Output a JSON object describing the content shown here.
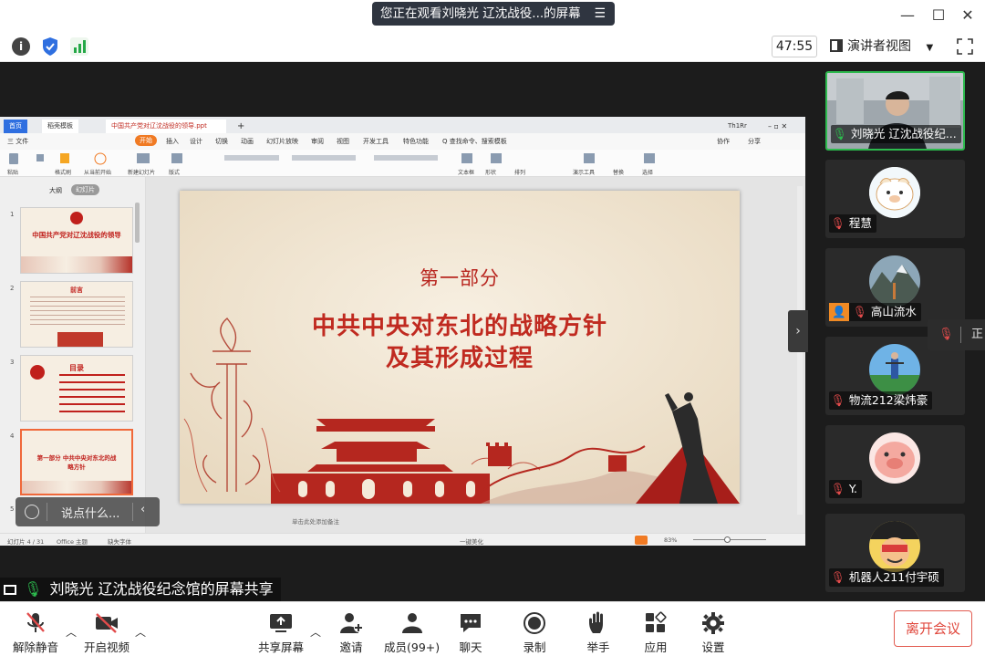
{
  "banner": {
    "text": "您正在观看刘晓光 辽沈战役...的屏幕"
  },
  "toolbar": {
    "timer": "47:55",
    "view_label": "演讲者视图"
  },
  "wps": {
    "tabs": [
      "首页",
      "稻壳模板",
      "中国共产党对辽沈战役的领导.ppt"
    ],
    "user": "Th1Rr",
    "menu": [
      "三 文件",
      "开始",
      "插入",
      "设计",
      "切换",
      "动画",
      "幻灯片放映",
      "审阅",
      "视图",
      "开发工具",
      "特色功能",
      "Q 查找命令、搜索模板"
    ],
    "menu_right": [
      "协作",
      "分享"
    ],
    "ribbon": [
      "粘贴",
      "格式刷",
      "从当前开始",
      "新建幻灯片",
      "版式",
      "文本框",
      "形状",
      "排列",
      "演示工具",
      "替换",
      "选择"
    ],
    "panel_tabs": [
      "大纲",
      "幻灯片"
    ],
    "thumbs": [
      {
        "num": "1",
        "title": "中国共产党对辽沈战役的领导"
      },
      {
        "num": "2",
        "title": "前言"
      },
      {
        "num": "3",
        "title": "目录"
      },
      {
        "num": "4",
        "title": "第一部分 中共中央对东北的战略方针"
      },
      {
        "num": "5",
        "title": ""
      }
    ],
    "slide": {
      "subtitle": "第一部分",
      "title_line1": "中共中央对东北的战略方针",
      "title_line2": "及其形成过程"
    },
    "notes_hint": "单击此处添加备注",
    "status": {
      "slide_count": "幻灯片 4 / 31",
      "theme": "Office 主题",
      "font_missing": "缺失字体",
      "beautify": "一键美化",
      "zoom": "83%"
    }
  },
  "chat": {
    "placeholder": "说点什么..."
  },
  "share_label": "刘晓光 辽沈战役纪念馆的屏幕共享",
  "participants": [
    {
      "name": "刘晓光 辽沈战役纪...",
      "active": true
    },
    {
      "name": "程慧"
    },
    {
      "name": "高山流水"
    },
    {
      "name": "物流212梁炜豪"
    },
    {
      "name": "Y."
    },
    {
      "name": "机器人211付宇硕"
    }
  ],
  "speaker_popup": "正",
  "bottom": {
    "unmute": "解除静音",
    "start_video": "开启视频",
    "share_screen": "共享屏幕",
    "invite": "邀请",
    "members": "成员(99+)",
    "chat": "聊天",
    "record": "录制",
    "raise_hand": "举手",
    "apps": "应用",
    "settings": "设置",
    "leave": "离开会议"
  },
  "colors": {
    "accent": "#2dba4e",
    "leave": "#e0473c",
    "slide_title": "#c02a20"
  }
}
